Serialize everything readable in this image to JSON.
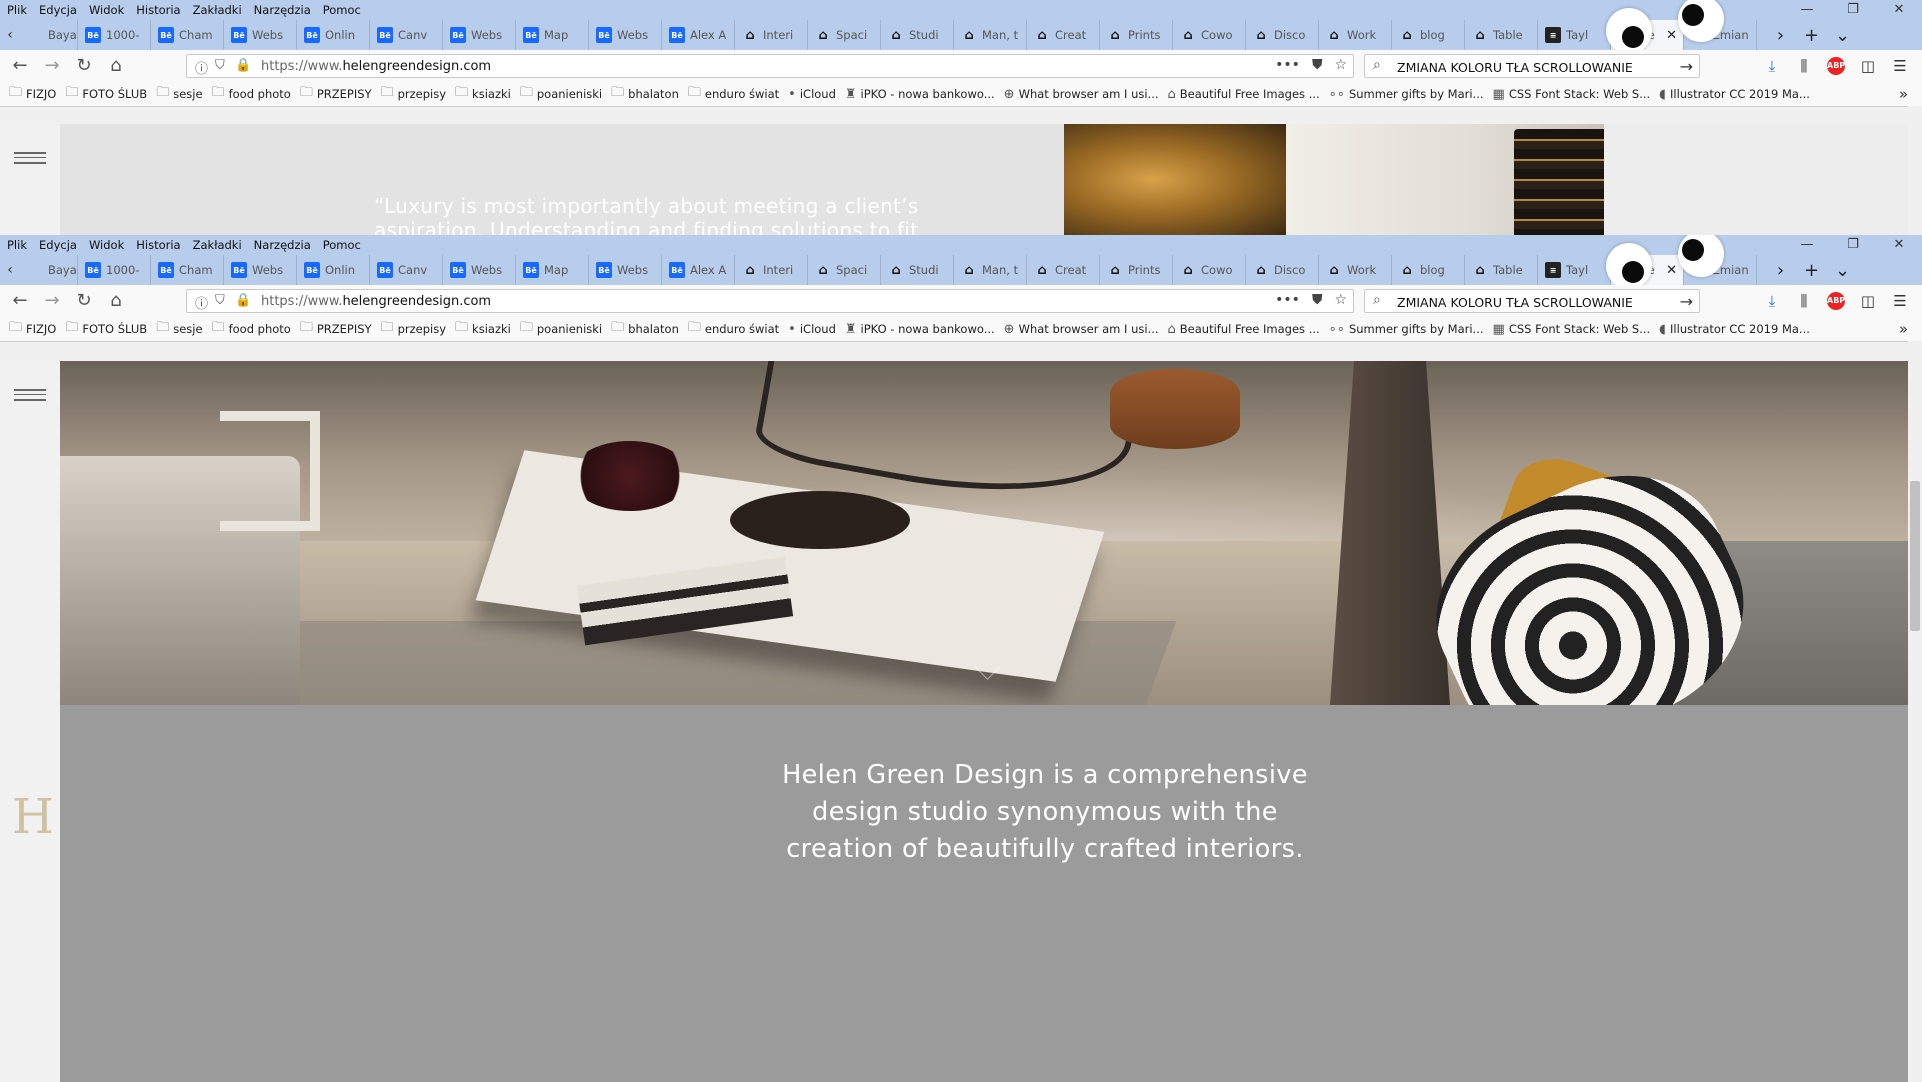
{
  "menu": [
    "Plik",
    "Edycja",
    "Widok",
    "Historia",
    "Zakładki",
    "Narzędzia",
    "Pomoc"
  ],
  "tabs": [
    {
      "title": "Bayan",
      "icon": "bayan-icon",
      "fav": ""
    },
    {
      "title": "1000-",
      "icon": "behance-icon",
      "fav": "Bē"
    },
    {
      "title": "Cham",
      "icon": "behance-icon",
      "fav": "Bē"
    },
    {
      "title": "Webs",
      "icon": "behance-icon",
      "fav": "Bē"
    },
    {
      "title": "Onlin",
      "icon": "behance-icon",
      "fav": "Bē"
    },
    {
      "title": "Canv",
      "icon": "behance-icon",
      "fav": "Bē"
    },
    {
      "title": "Webs",
      "icon": "behance-icon",
      "fav": "Bē"
    },
    {
      "title": "Map",
      "icon": "behance-icon",
      "fav": "Bē"
    },
    {
      "title": "Webs",
      "icon": "behance-icon",
      "fav": "Bē"
    },
    {
      "title": "Alex A",
      "icon": "behance-icon",
      "fav": "Bē"
    },
    {
      "title": "Interi",
      "icon": "unsplash-icon",
      "fav": "⌂"
    },
    {
      "title": "Spaci",
      "icon": "unsplash-icon",
      "fav": "⌂"
    },
    {
      "title": "Studi",
      "icon": "unsplash-icon",
      "fav": "⌂"
    },
    {
      "title": "Man, t",
      "icon": "unsplash-icon",
      "fav": "⌂"
    },
    {
      "title": "Creat",
      "icon": "unsplash-icon",
      "fav": "⌂"
    },
    {
      "title": "Prints",
      "icon": "unsplash-icon",
      "fav": "⌂"
    },
    {
      "title": "Cowo",
      "icon": "unsplash-icon",
      "fav": "⌂"
    },
    {
      "title": "Disco",
      "icon": "unsplash-icon",
      "fav": "⌂"
    },
    {
      "title": "Work",
      "icon": "unsplash-icon",
      "fav": "⌂"
    },
    {
      "title": "blog",
      "icon": "unsplash-icon",
      "fav": "⌂"
    },
    {
      "title": "Table",
      "icon": "unsplash-icon",
      "fav": "⌂"
    },
    {
      "title": "Tayl",
      "icon": "dark-icon",
      "fav": "≡"
    },
    {
      "title": "He",
      "icon": "helen-icon",
      "fav": "H",
      "active": true
    },
    {
      "title": "Zmian",
      "icon": "firefox-icon",
      "fav": ""
    }
  ],
  "url": {
    "prefix": "https://www.",
    "domain": "helengreendesign.com"
  },
  "search": {
    "value": "ZMIANA KOLORU TŁA SCROLLOWANIE"
  },
  "bookmarks": [
    {
      "label": "FIZJO",
      "icon": "folder-icon"
    },
    {
      "label": "FOTO ŚLUB",
      "icon": "folder-icon"
    },
    {
      "label": "sesje",
      "icon": "folder-icon"
    },
    {
      "label": "food photo",
      "icon": "folder-icon"
    },
    {
      "label": "PRZEPISY",
      "icon": "folder-icon"
    },
    {
      "label": "przepisy",
      "icon": "folder-icon"
    },
    {
      "label": "ksiazki",
      "icon": "folder-icon"
    },
    {
      "label": "poanieniski",
      "icon": "folder-icon"
    },
    {
      "label": "bhalaton",
      "icon": "folder-icon"
    },
    {
      "label": "enduro świat",
      "icon": "folder-icon"
    },
    {
      "label": "iCloud",
      "icon": "apple-icon"
    },
    {
      "label": "iPKO - nowa bankowo...",
      "icon": "pko-icon"
    },
    {
      "label": "What browser am I usi...",
      "icon": "globe-icon"
    },
    {
      "label": "Beautiful Free Images ...",
      "icon": "unsplash-icon"
    },
    {
      "label": "Summer gifts by Mari...",
      "icon": "dots-icon"
    },
    {
      "label": "CSS Font Stack: Web S...",
      "icon": "css-icon"
    },
    {
      "label": "Illustrator CC 2019 Ma...",
      "icon": "adobe-icon"
    }
  ],
  "page_top": {
    "quote_line1": "“Luxury is most importantly about meeting a client’s",
    "quote_line2": "aspiration. Understanding and finding solutions to fit"
  },
  "page_bottom": {
    "intro_line1": "Helen Green Design is a comprehensive",
    "intro_line2": "design studio synonymous with the",
    "intro_line3": "creation of beautifully crafted interiors.",
    "logo_letter": "H"
  },
  "colors": {
    "menubar": "#b7cdeb",
    "gray_section": "#9b9b9b",
    "logo": "#cfc1a2"
  }
}
